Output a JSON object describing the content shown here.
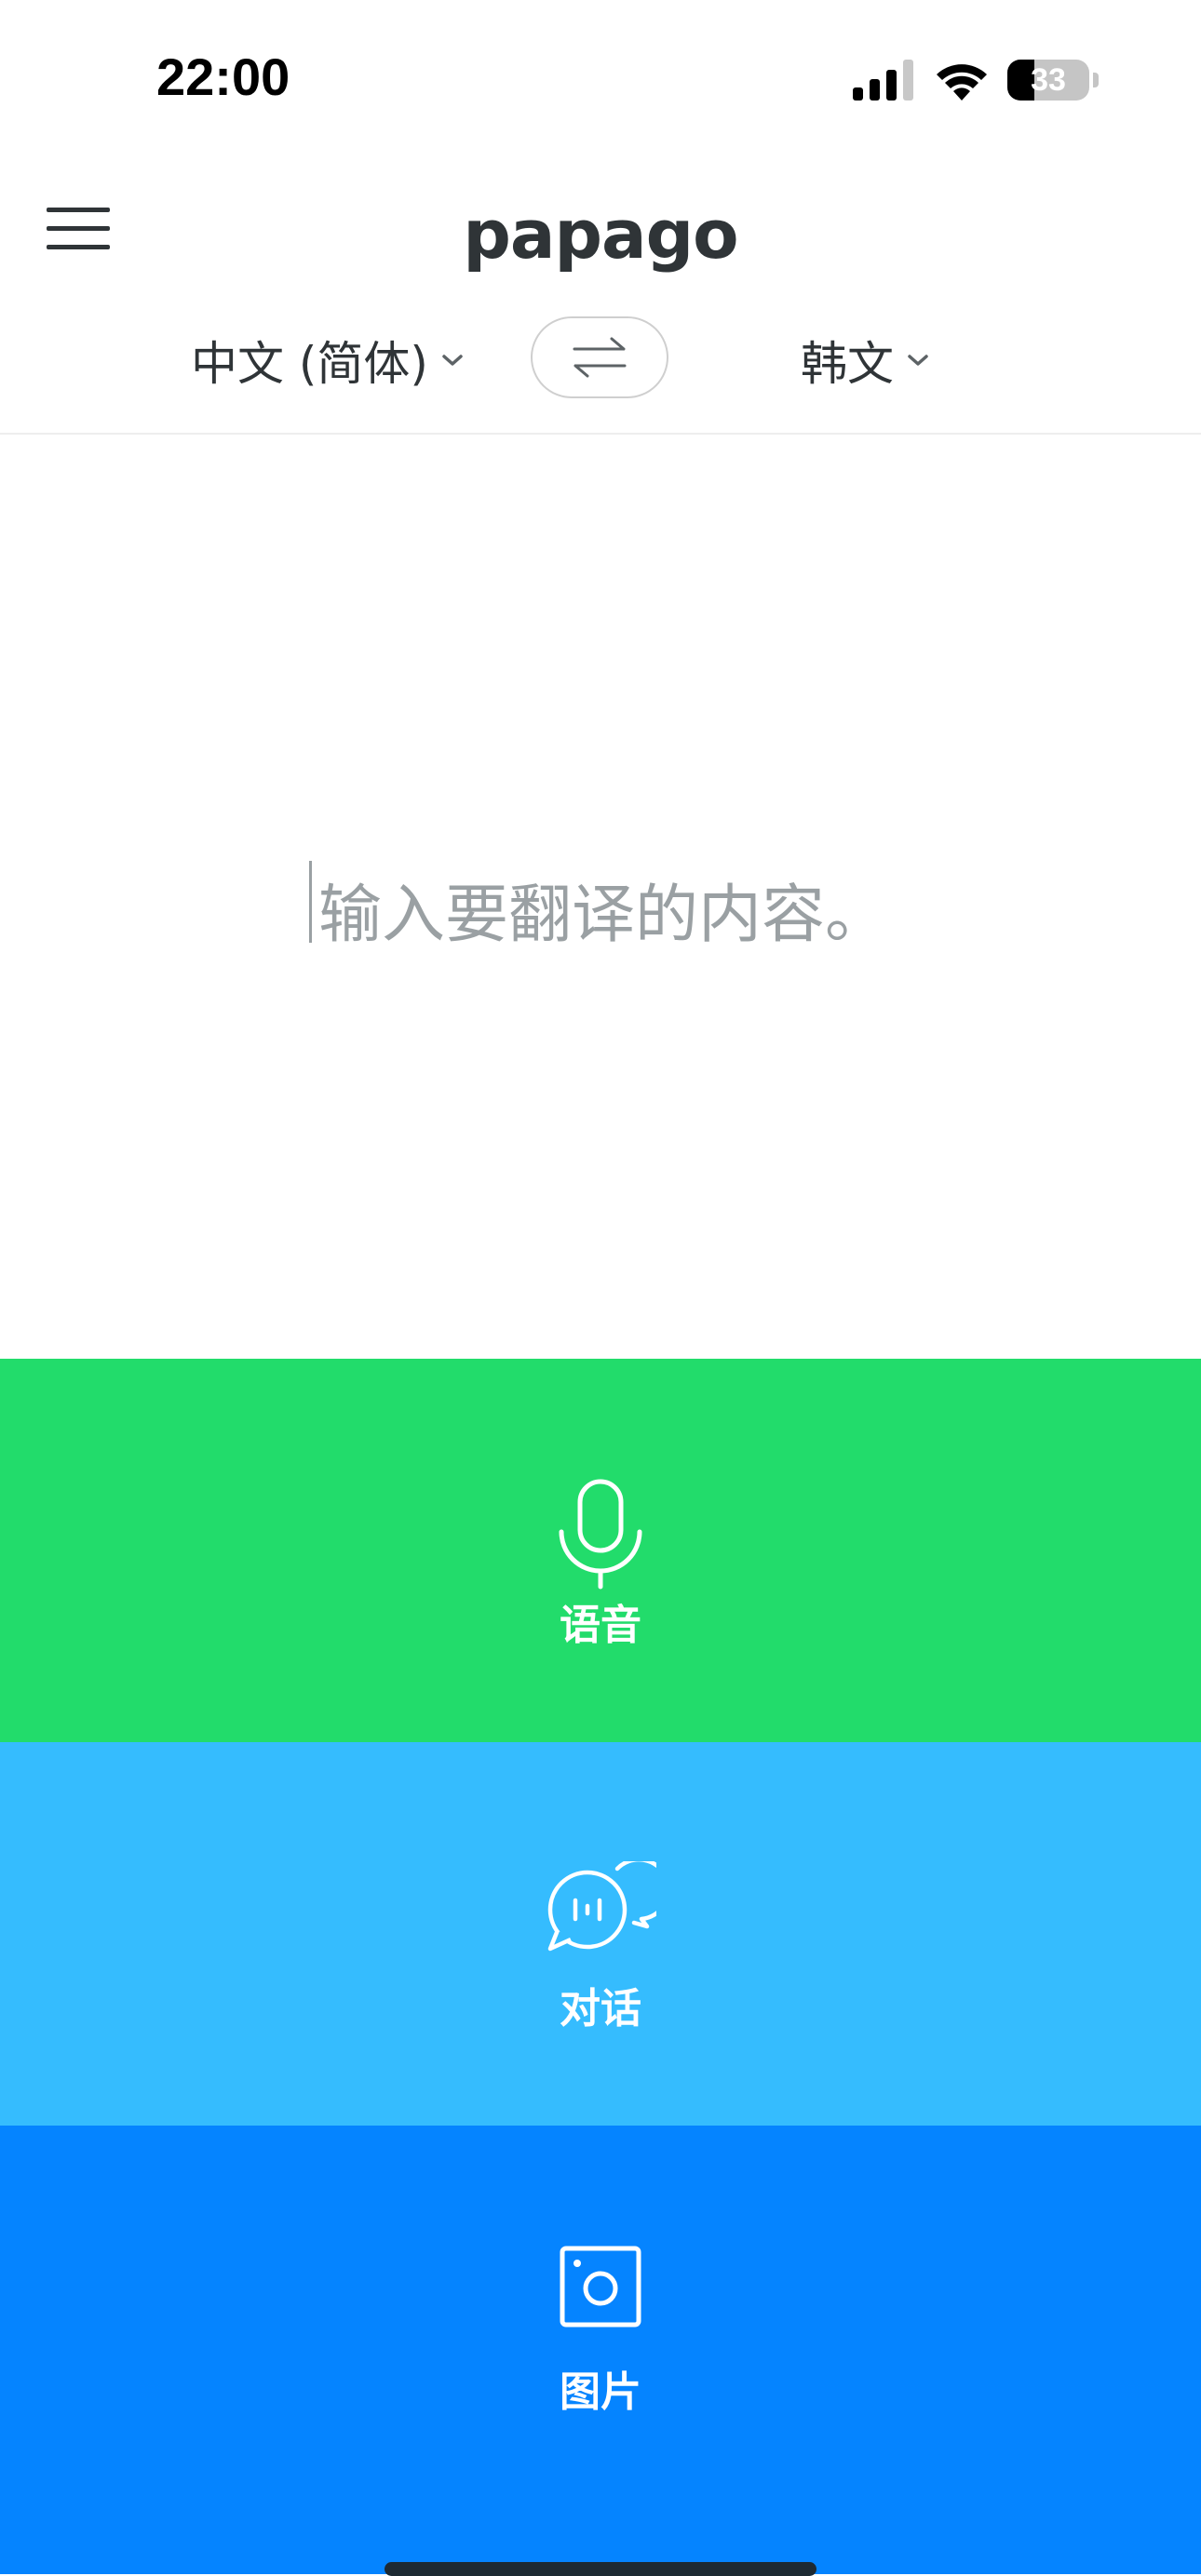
{
  "status_bar": {
    "time": "22:00",
    "battery_level": "33",
    "battery_fraction": 0.33,
    "icons": [
      "cellular-signal-icon",
      "wifi-icon",
      "battery-icon"
    ]
  },
  "header": {
    "logo": "papago",
    "menu_icon": "hamburger-menu-icon"
  },
  "language_bar": {
    "source_language": "中文 (简体)",
    "target_language": "韩文",
    "swap_icon": "swap-arrows-icon",
    "dropdown_icon": "chevron-down-icon"
  },
  "input": {
    "placeholder": "输入要翻译的内容。"
  },
  "modes": [
    {
      "label": "语音",
      "icon": "microphone-icon",
      "color": "#22dc6b"
    },
    {
      "label": "对话",
      "icon": "conversation-bubbles-icon",
      "color": "#35bcfe"
    },
    {
      "label": "图片",
      "icon": "camera-icon",
      "color": "#0584ff"
    }
  ],
  "colors": {
    "text": "#2f3437",
    "placeholder": "#9aa0a3"
  }
}
